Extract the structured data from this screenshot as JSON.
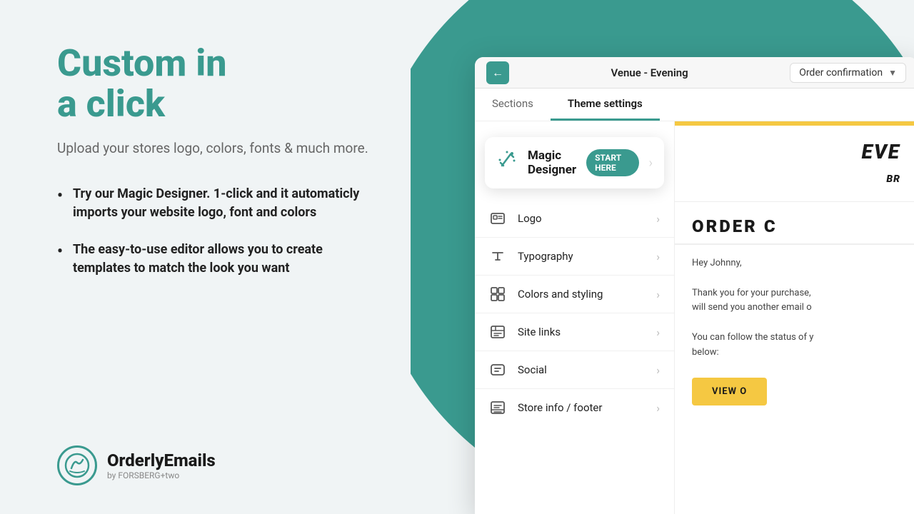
{
  "left": {
    "heading_line1": "Custom in",
    "heading_line2": "a click",
    "subtitle": "Upload your stores logo, colors, fonts & much more.",
    "bullets": [
      "Try our Magic Designer. 1-click and it automaticly imports your website logo, font and colors",
      "The easy-to-use editor allows you to create templates to match the look you want"
    ],
    "brand_name": "OrderlyEmails",
    "brand_sub": "by FORSBERG+two"
  },
  "browser": {
    "back_icon": "←",
    "venue_label": "Venue - Evening",
    "order_select_label": "Order confirmation",
    "tab_sections": "Sections",
    "tab_theme": "Theme settings"
  },
  "magic_designer": {
    "label": "Magic Designer",
    "badge": "START HERE",
    "arrow": "›"
  },
  "menu_items": [
    {
      "id": "logo",
      "label": "Logo"
    },
    {
      "id": "typography",
      "label": "Typography"
    },
    {
      "id": "colors",
      "label": "Colors and styling"
    },
    {
      "id": "sitelinks",
      "label": "Site links"
    },
    {
      "id": "social",
      "label": "Social"
    },
    {
      "id": "storefooter",
      "label": "Store info / footer"
    }
  ],
  "email_preview": {
    "brand_text": "EVE",
    "brand_text2": "BR",
    "order_heading": "ORDER C",
    "greeting": "Hey Johnny,",
    "body1": "Thank you for your purchase,",
    "body2": "will send you another email o",
    "body3": "You can follow the status of y",
    "body4": "below:",
    "view_order_btn": "VIEW O"
  },
  "colors": {
    "teal": "#3a9a8f",
    "yellow": "#f5c842",
    "text_dark": "#1a1a1a",
    "text_gray": "#666",
    "bg": "#f0f4f5"
  }
}
